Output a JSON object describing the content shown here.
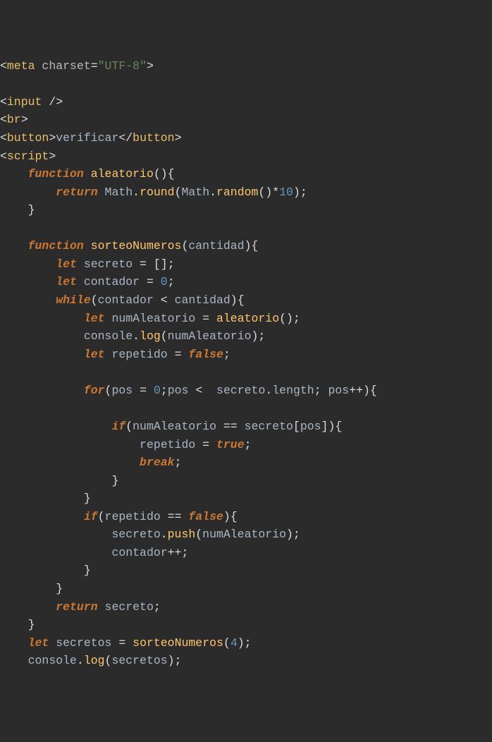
{
  "code": {
    "l1": {
      "open": "<",
      "tag": "meta",
      "sp": " ",
      "attr": "charset",
      "eq": "=",
      "q1": "\"",
      "val": "UTF-8",
      "q2": "\"",
      "close": ">"
    },
    "l3": {
      "open": "<",
      "tag": "input",
      "sp": " ",
      "close": "/>"
    },
    "l4": {
      "open": "<",
      "tag": "br",
      "close": ">"
    },
    "l5": {
      "open1": "<",
      "tag1": "button",
      "close1": ">",
      "text": "verificar",
      "open2": "</",
      "tag2": "button",
      "close2": ">"
    },
    "l6": {
      "open": "<",
      "tag": "script",
      "close": ">"
    },
    "l7": {
      "kw": "function",
      "sp": " ",
      "name": "aleatorio",
      "paren": "(){"
    },
    "l8": {
      "kw": "return",
      "sp": " ",
      "id1": "Math",
      "dot1": ".",
      "m1": "round",
      "p1": "(",
      "id2": "Math",
      "dot2": ".",
      "m2": "random",
      "p2": "()",
      "op": "*",
      "num": "10",
      "end": ");"
    },
    "l9": {
      "brace": "}"
    },
    "l11": {
      "kw": "function",
      "sp": " ",
      "name": "sorteoNumeros",
      "p1": "(",
      "arg": "cantidad",
      "p2": "){"
    },
    "l12": {
      "kw": "let",
      "sp": " ",
      "id": "secreto",
      "eq": " = ",
      "val": "[]",
      "end": ";"
    },
    "l13": {
      "kw": "let",
      "sp": " ",
      "id": "contador",
      "eq": " = ",
      "num": "0",
      "end": ";"
    },
    "l14": {
      "kw": "while",
      "p1": "(",
      "id1": "contador",
      "op": " < ",
      "id2": "cantidad",
      "p2": "){"
    },
    "l15": {
      "kw": "let",
      "sp": " ",
      "id": "numAleatorio",
      "eq": " = ",
      "fn": "aleatorio",
      "end": "();"
    },
    "l16": {
      "id1": "console",
      "dot": ".",
      "m": "log",
      "p1": "(",
      "arg": "numAleatorio",
      "end": ");"
    },
    "l17": {
      "kw": "let",
      "sp": " ",
      "id": "repetido",
      "eq": " = ",
      "val": "false",
      "end": ";"
    },
    "l19": {
      "kw": "for",
      "p1": "(",
      "id1": "pos",
      "eq": " = ",
      "num": "0",
      "semi": ";",
      "id2": "pos",
      "op": " < ",
      "id3": " secreto",
      "dot": ".",
      "prop": "length",
      "semi2": "; ",
      "id4": "pos",
      "inc": "++",
      "p2": "){"
    },
    "l21": {
      "kw": "if",
      "p1": "(",
      "id1": "numAleatorio",
      "op": " == ",
      "id2": "secreto",
      "br1": "[",
      "id3": "pos",
      "br2": "]",
      "p2": "){"
    },
    "l22": {
      "id": "repetido",
      "eq": " = ",
      "val": "true",
      "end": ";"
    },
    "l23": {
      "kw": "break",
      "end": ";"
    },
    "l24": {
      "brace": "}"
    },
    "l25": {
      "brace": "}"
    },
    "l26": {
      "kw": "if",
      "p1": "(",
      "id": "repetido",
      "op": " == ",
      "val": "false",
      "p2": "){"
    },
    "l27": {
      "id1": "secreto",
      "dot": ".",
      "m": "push",
      "p1": "(",
      "arg": "numAleatorio",
      "end": ");"
    },
    "l28": {
      "id": "contador",
      "inc": "++",
      "end": ";"
    },
    "l29": {
      "brace": "}"
    },
    "l30": {
      "brace": "}"
    },
    "l31": {
      "kw": "return",
      "sp": " ",
      "id": "secreto",
      "end": ";"
    },
    "l32": {
      "brace": "}"
    },
    "l33": {
      "kw": "let",
      "sp": " ",
      "id": "secretos",
      "eq": " = ",
      "fn": "sorteoNumeros",
      "p1": "(",
      "num": "4",
      "end": ");"
    },
    "l34": {
      "id1": "console",
      "dot": ".",
      "m": "log",
      "p1": "(",
      "arg": "secretos",
      "end": ");"
    }
  }
}
